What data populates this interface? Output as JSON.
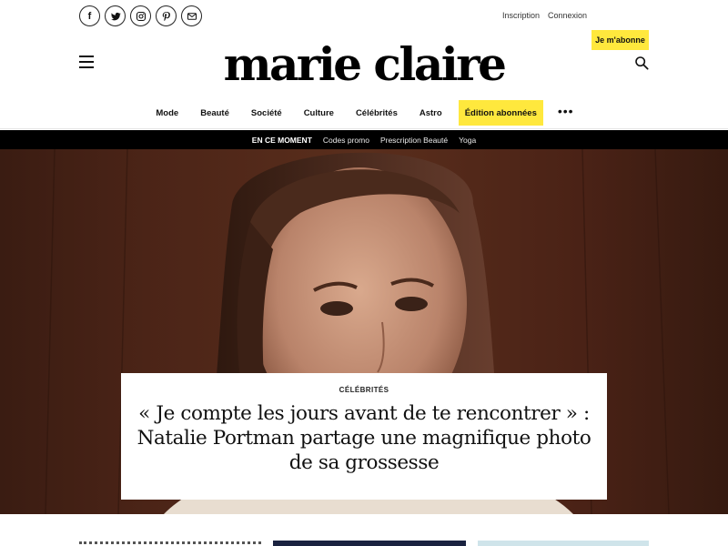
{
  "header": {
    "social": [
      {
        "name": "facebook-icon",
        "glyph": "f"
      },
      {
        "name": "twitter-icon",
        "glyph": ""
      },
      {
        "name": "instagram-icon",
        "glyph": ""
      },
      {
        "name": "pinterest-icon",
        "glyph": "P"
      },
      {
        "name": "mail-icon",
        "glyph": ""
      }
    ],
    "signup_label": "Inscription",
    "login_label": "Connexion",
    "subscribe_label": "Je m'abonne",
    "logo_text": "marie claire"
  },
  "nav": {
    "items": [
      "Mode",
      "Beauté",
      "Société",
      "Culture",
      "Célébrités",
      "Astro"
    ],
    "highlight_label": "Édition abonnées",
    "more_label": "•••"
  },
  "trending": {
    "lead": "EN CE MOMENT",
    "links": [
      "Codes promo",
      "Prescription Beauté",
      "Yoga"
    ]
  },
  "hero": {
    "category": "CÉLÉBRITÉS",
    "title": "« Je compte les jours avant de te rencontrer » : Natalie Portman partage une magnifique photo de sa grossesse"
  },
  "colors": {
    "accent_yellow": "#ffe83d",
    "trend_bar": "#000000"
  }
}
